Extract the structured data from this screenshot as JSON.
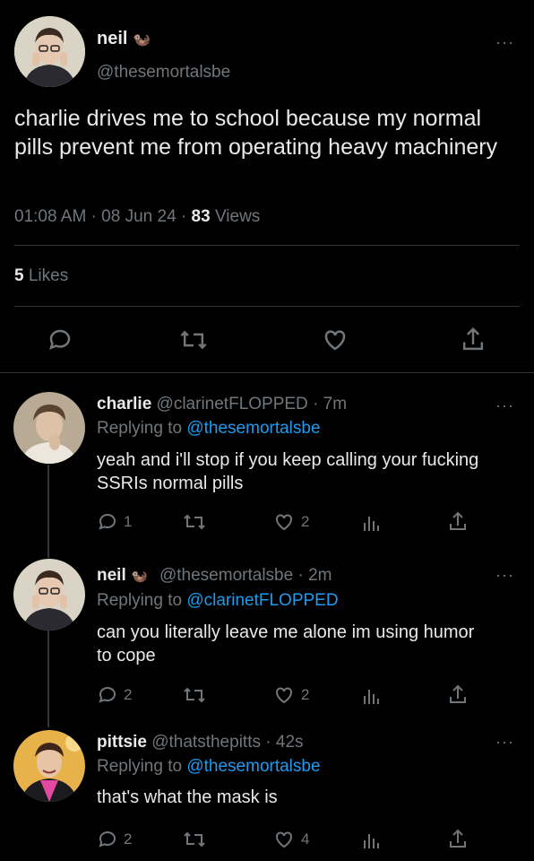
{
  "main_tweet": {
    "author_name": "neil",
    "author_emoji": "🦦",
    "handle": "@thesemortalsbe",
    "text": "charlie drives me to school because my normal pills prevent me from operating heavy machinery",
    "time": "01:08 AM",
    "date": "08 Jun 24",
    "views_count": "83",
    "views_label": "Views",
    "likes_count": "5",
    "likes_label": "Likes",
    "more": "···"
  },
  "replies": [
    {
      "name": "charlie",
      "handle": "@clarinetFLOPPED",
      "time": "· 7m",
      "replying_prefix": "Replying to",
      "replying_to": "@thesemortalsbe",
      "text": "yeah and i'll stop if you keep calling your fucking SSRIs normal pills",
      "reply_count": "1",
      "retweet_count": "",
      "like_count": "2",
      "more": "···"
    },
    {
      "name": "neil",
      "emoji": "🦦",
      "handle": "@thesemortalsbe",
      "time": "· 2m",
      "replying_prefix": "Replying to",
      "replying_to": "@clarinetFLOPPED",
      "text": "can you literally leave me alone im using humor to cope",
      "reply_count": "2",
      "retweet_count": "",
      "like_count": "2",
      "more": "···"
    },
    {
      "name": "pittsie",
      "handle": "@thatsthepitts",
      "time": "· 42s",
      "replying_prefix": "Replying to",
      "replying_to": "@thesemortalsbe",
      "text": "that's what the mask is",
      "reply_count": "2",
      "retweet_count": "",
      "like_count": "4",
      "more": "···"
    }
  ],
  "colors": {
    "background": "#000000",
    "text": "#e7e9ea",
    "muted": "#71767b",
    "link": "#1d9bf0",
    "divider": "#2f3336"
  },
  "icons": [
    "reply-icon",
    "retweet-icon",
    "like-icon",
    "analytics-icon",
    "share-icon",
    "more-icon"
  ]
}
